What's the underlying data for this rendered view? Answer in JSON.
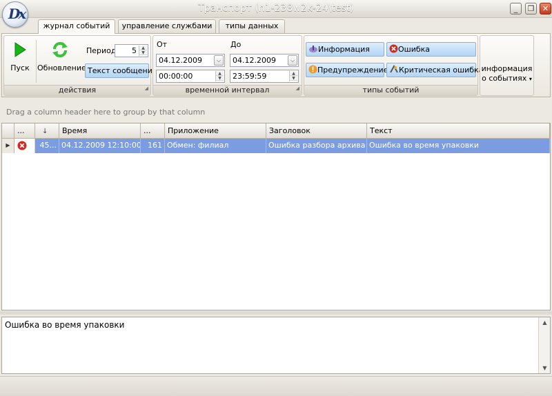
{
  "window": {
    "title": "Транспорт (n1-238w2k-24\\test)",
    "logo_text": "Dx",
    "controls": {
      "minimize": "_",
      "restore": "❐",
      "close": "✕"
    }
  },
  "tabs": [
    {
      "label": "журнал событий",
      "active": true
    },
    {
      "label": "управление службами",
      "active": false
    },
    {
      "label": "типы данных",
      "active": false
    }
  ],
  "ribbon": {
    "actions": {
      "caption": "действия",
      "start_label": "Пуск",
      "refresh_label": "Обновление",
      "period_label": "Период",
      "period_value": "5",
      "message_text_label": "Текст сообщения"
    },
    "interval": {
      "caption": "временной интервал",
      "from_label": "От",
      "to_label": "До",
      "from_date": "04.12.2009",
      "from_time": "00:00:00",
      "to_date": "04.12.2009",
      "to_time": "23:59:59"
    },
    "event_types": {
      "caption": "типы событий",
      "info": "Информация",
      "error": "Ошибка",
      "warning": "Предупреждение",
      "critical": "Критическая ошибка"
    },
    "info_button": {
      "line1": "информация",
      "line2": "о событиях"
    }
  },
  "grid": {
    "group_hint": "Drag a column header here to group by that column",
    "columns": [
      "...",
      "",
      "Время",
      "...",
      "Приложение",
      "Заголовок",
      "Текст"
    ],
    "rows": [
      {
        "id": "45...",
        "time": "04.12.2009 12:10:00",
        "num": "161",
        "application": "Обмен: филиал",
        "caption": "Ошибка разбора архива",
        "text": "Ошибка во время упаковки"
      }
    ]
  },
  "message": {
    "text": "Ошибка во время упаковки"
  },
  "colors": {
    "selected_row": "#7b9ce0",
    "error_icon": "#d42a1e",
    "start_icon": "#18b418",
    "refresh_icon": "#3cc23c"
  }
}
